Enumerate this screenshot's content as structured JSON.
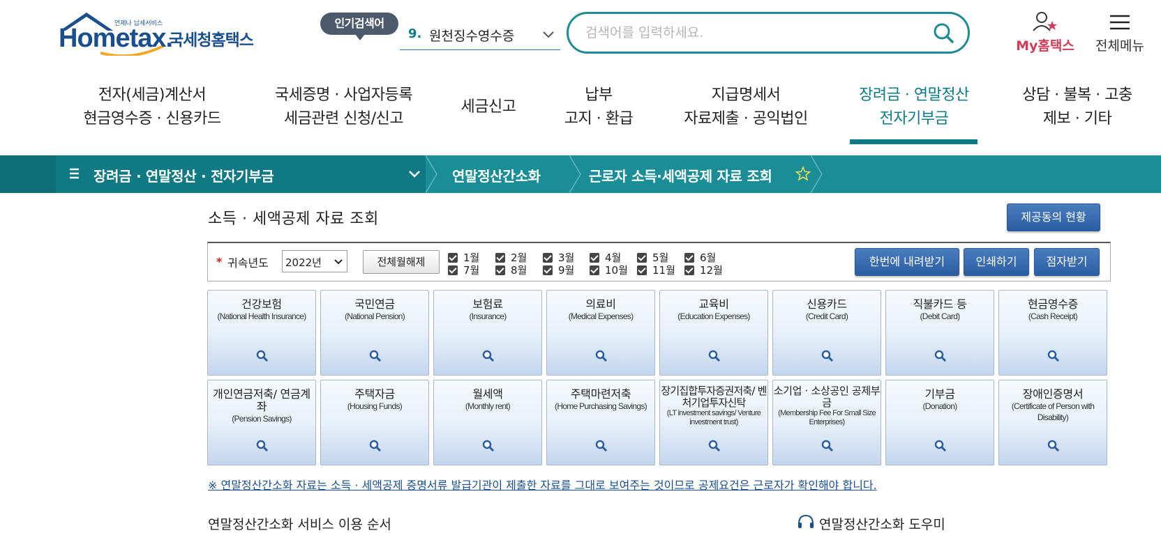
{
  "header": {
    "logo_small": "언제나 납세서비스",
    "logo_brand": "Hometax.",
    "logo_korean": "국세청홈택스",
    "popular_badge": "인기검색어",
    "popular_rank": "9.",
    "popular_term": "원천징수영수증",
    "search_placeholder": "검색어를 입력하세요.",
    "my_hometax": "My홈택스",
    "all_menu": "전체메뉴"
  },
  "nav": {
    "items": [
      {
        "line1": "전자(세금)계산서",
        "line2": "현금영수증 · 신용카드"
      },
      {
        "line1": "국세증명 · 사업자등록",
        "line2": "세금관련 신청/신고"
      },
      {
        "line1": "세금신고",
        "line2": ""
      },
      {
        "line1": "납부",
        "line2": "고지 · 환급"
      },
      {
        "line1": "지급명세서",
        "line2": "자료제출 · 공익법인"
      },
      {
        "line1": "장려금 · 연말정산",
        "line2": "전자기부금"
      },
      {
        "line1": "상담 · 불복 · 고충",
        "line2": "제보 · 기타"
      }
    ]
  },
  "breadcrumb": {
    "section": "장려금 · 연말정산 · 전자기부금",
    "sub": "연말정산간소화",
    "current": "근로자 소득·세액공제 자료 조회"
  },
  "page": {
    "title": "소득 · 세액공제 자료 조회",
    "provider_status_btn": "제공동의 현황"
  },
  "filter": {
    "year_label": "귀속년도",
    "year_value": "2022년",
    "deselect_btn": "전체월해제",
    "months_top": [
      "1월",
      "2월",
      "3월",
      "4월",
      "5월",
      "6월"
    ],
    "months_bottom": [
      "7월",
      "8월",
      "9월",
      "10월",
      "11월",
      "12월"
    ],
    "download_btn": "한번에 내려받기",
    "print_btn": "인쇄하기",
    "braille_btn": "점자받기"
  },
  "tiles": [
    {
      "ko": "건강보험",
      "en": "(National Health Insurance)"
    },
    {
      "ko": "국민연금",
      "en": "(National Pension)"
    },
    {
      "ko": "보험료",
      "en": "(Insurance)"
    },
    {
      "ko": "의료비",
      "en": "(Medical Expenses)"
    },
    {
      "ko": "교육비",
      "en": "(Education Expenses)"
    },
    {
      "ko": "신용카드",
      "en": "(Credit Card)"
    },
    {
      "ko": "직불카드 등",
      "en": "(Debit Card)"
    },
    {
      "ko": "현금영수증",
      "en": "(Cash Receipt)"
    },
    {
      "ko": "개인연금저축/ 연금계좌",
      "en": "(Pension Savings)"
    },
    {
      "ko": "주택자금",
      "en": "(Housing Funds)"
    },
    {
      "ko": "월세액",
      "en": "(Monthly rent)"
    },
    {
      "ko": "주택마련저축",
      "en": "(Home Purchasing Savings)"
    },
    {
      "ko": "장기집합투자증권저축/ 벤처기업투자신탁",
      "en": "(LT investment savings/ Venture investment trust)"
    },
    {
      "ko": "소기업 · 소상공인 공제부금",
      "en": "(Membership Fee For Small Size Enterprises)"
    },
    {
      "ko": "기부금",
      "en": "(Donation)"
    },
    {
      "ko": "장애인증명서",
      "en": "(Certificate of Person with Disability)"
    }
  ],
  "notice": "※ 연말정산간소화 자료는 소득 · 세액공제 증명서류 발급기관이 제출한 자료를 그대로 보여주는 것이므로 공제요건은 근로자가 확인해야 합니다.",
  "bottom": {
    "service_order": "연말정산간소화 서비스 이용 순서",
    "helper": "연말정산간소화 도우미"
  },
  "colors": {
    "teal": "#1b8d97",
    "teal_dark": "#0f6e77",
    "brand_blue": "#1a4f8f",
    "button_blue": "#2b5da3",
    "my_red": "#d03d5a"
  }
}
